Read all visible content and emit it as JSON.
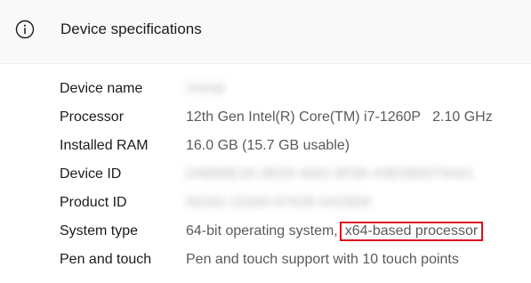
{
  "header": {
    "title": "Device specifications",
    "icon": "info-icon"
  },
  "specs": [
    {
      "label": "Device name",
      "value": "Vishal",
      "obscured": true
    },
    {
      "label": "Processor",
      "value": "12th Gen Intel(R) Core(TM) i7-1260P   2.10 GHz",
      "obscured": false
    },
    {
      "label": "Installed RAM",
      "value": "16.0 GB (15.7 GB usable)",
      "obscured": false
    },
    {
      "label": "Device ID",
      "value": "D4B89E3A-9E59-4662-8F89-A9E5B6079A61",
      "obscured": true
    },
    {
      "label": "Product ID",
      "value": "00342-22093-67628-AAOEM",
      "obscured": true
    },
    {
      "label": "System type",
      "value": "64-bit operating system, x64-based processor",
      "value_part1": "64-bit operating system,",
      "value_highlight": "x64-based processor",
      "obscured": false
    },
    {
      "label": "Pen and touch",
      "value": "Pen and touch support with 10 touch points",
      "obscured": false
    }
  ],
  "colors": {
    "highlight_border": "#d9111d",
    "label_text": "#1b1b1b",
    "value_text": "#5a5a5a",
    "header_bg": "#f9f9f9"
  }
}
